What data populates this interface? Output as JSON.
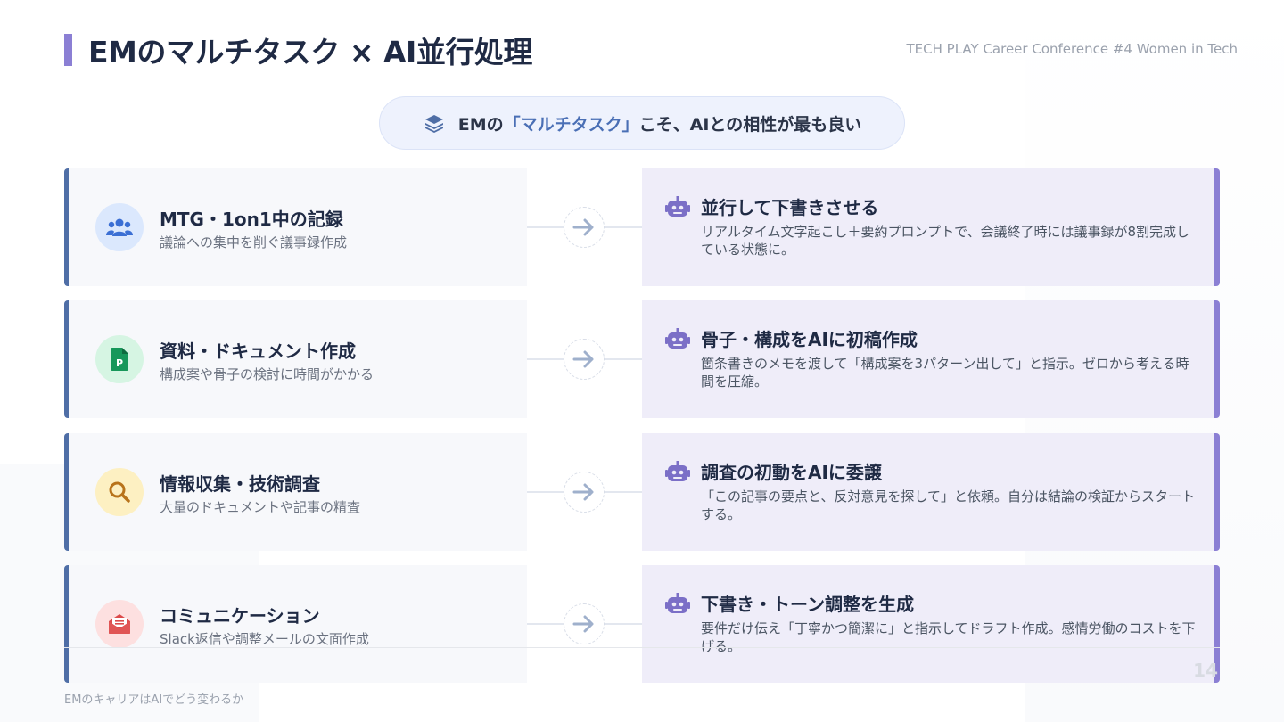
{
  "header": {
    "title": "EMのマルチタスク × AI並行処理",
    "event": "TECH PLAY Career Conference #4 Women in Tech"
  },
  "tagline": {
    "before": "EMの",
    "highlight": "「マルチタスク」",
    "after": "こそ、AIとの相性が最も良い",
    "icon": "layers-icon"
  },
  "rows": [
    {
      "task_title": "MTG・1on1中の記録",
      "task_sub": "議論への集中を削ぐ議事録作成",
      "task_icon": "users-icon",
      "ai_title": "並行して下書きさせる",
      "ai_desc": "リアルタイム文字起こし＋要約プロンプトで、会議終了時には議事録が8割完成している状態に。"
    },
    {
      "task_title": "資料・ドキュメント作成",
      "task_sub": "構成案や骨子の検討に時間がかかる",
      "task_icon": "slides-file-icon",
      "ai_title": "骨子・構成をAIに初稿作成",
      "ai_desc": "箇条書きのメモを渡して「構成案を3パターン出して」と指示。ゼロから考える時間を圧縮。"
    },
    {
      "task_title": "情報収集・技術調査",
      "task_sub": "大量のドキュメントや記事の精査",
      "task_icon": "search-icon",
      "ai_title": "調査の初動をAIに委譲",
      "ai_desc": "「この記事の要点と、反対意見を探して」と依頼。自分は結論の検証からスタートする。"
    },
    {
      "task_title": "コミュニケーション",
      "task_sub": "Slack返信や調整メールの文面作成",
      "task_icon": "mail-icon",
      "ai_title": "下書き・トーン調整を生成",
      "ai_desc": "要件だけ伝え「丁寧かつ簡潔に」と指示してドラフト作成。感情労働のコストを下げる。"
    }
  ],
  "footer": {
    "text": "EMのキャリアはAIでどう変わるか",
    "page": "14"
  },
  "colors": {
    "accent_purple": "#8b7fd4",
    "accent_blue": "#4f6ea6",
    "title": "#1f2a44"
  }
}
